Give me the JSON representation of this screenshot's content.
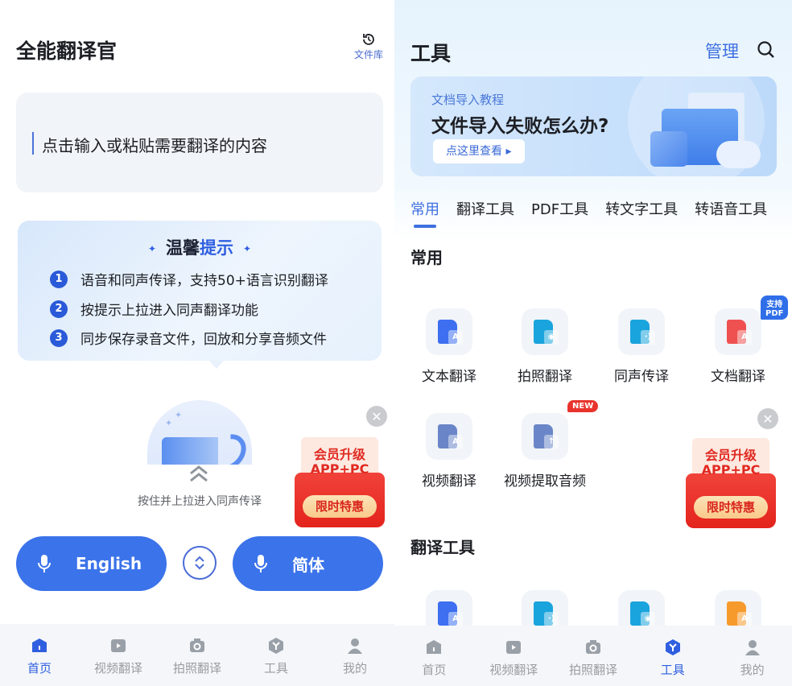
{
  "left": {
    "title": "全能翻译官",
    "file_library": {
      "icon": "history-icon",
      "label": "文件库"
    },
    "input": {
      "placeholder": "点击输入或粘贴需要翻译的内容"
    },
    "tips": {
      "title_dark": "温馨",
      "title_blue": "提示",
      "items": [
        {
          "num": "1",
          "text": "语音和同声传译，支持50+语言识别翻译"
        },
        {
          "num": "2",
          "text": "按提示上拉进入同声翻译功能"
        },
        {
          "num": "3",
          "text": "同步保存录音文件，回放和分享音频文件"
        }
      ]
    },
    "pull_hint": "按住并上拉进入同声传译",
    "promo": {
      "line1": "会员升级",
      "line2": "APP+PC",
      "pill": "限时特惠"
    },
    "source_lang": "English",
    "target_lang": "简体"
  },
  "right": {
    "title": "工具",
    "manage": "管理",
    "banner": {
      "subtitle": "文档导入教程",
      "headline": "文件导入失败怎么办?",
      "cta": "点这里查看 ▸"
    },
    "tabs": [
      "常用",
      "翻译工具",
      "PDF工具",
      "转文字工具",
      "转语音工具"
    ],
    "active_tab": "常用",
    "sections": {
      "common": {
        "title": "常用",
        "tools": [
          {
            "label": "文本翻译",
            "icon": "text-translate-icon",
            "color": "#3d6ff0",
            "sub": "A"
          },
          {
            "label": "拍照翻译",
            "icon": "photo-translate-icon",
            "color": "#1aa4dd",
            "sub": "◉"
          },
          {
            "label": "同声传译",
            "icon": "simultaneous-icon",
            "color": "#1aa4dd",
            "sub": "·)"
          },
          {
            "label": "文档翻译",
            "icon": "doc-translate-icon",
            "color": "#ef5050",
            "sub": "A",
            "badge": "支持PDF"
          },
          {
            "label": "视频翻译",
            "icon": "video-translate-icon",
            "color": "#6a86c8",
            "sub": "A"
          },
          {
            "label": "视频提取音频",
            "icon": "video-extract-audio-icon",
            "color": "#6a86c8",
            "sub": "↑",
            "badge": "NEW"
          }
        ]
      },
      "translate": {
        "title": "翻译工具",
        "tools": [
          {
            "icon": "text-translate-icon",
            "color": "#3d6ff0",
            "sub": "A"
          },
          {
            "icon": "simultaneous-icon",
            "color": "#1aa4dd",
            "sub": "·)"
          },
          {
            "icon": "photo-translate-icon",
            "color": "#1aa4dd",
            "sub": "◉"
          },
          {
            "icon": "doc-translate-icon",
            "color": "#f79a2c",
            "sub": "A"
          }
        ]
      }
    },
    "promo": {
      "line1": "会员升级",
      "line2": "APP+PC",
      "pill": "限时特惠"
    }
  },
  "tabbar": {
    "items": [
      "首页",
      "视频翻译",
      "拍照翻译",
      "工具",
      "我的"
    ],
    "left_active": "首页",
    "right_active": "工具"
  },
  "colors": {
    "accent": "#3b73ea",
    "promo_red": "#e3231c"
  }
}
